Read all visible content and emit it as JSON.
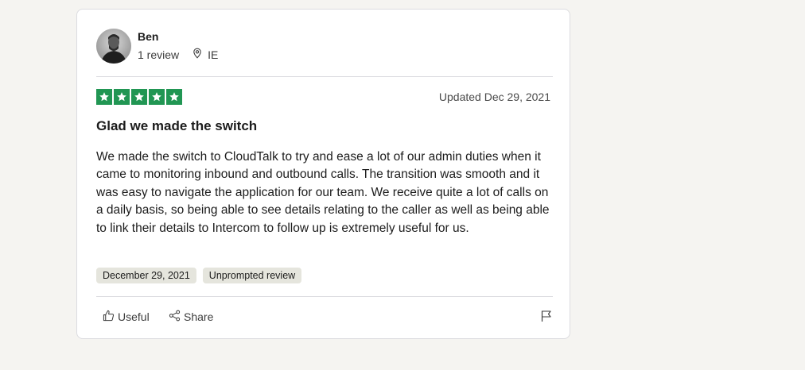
{
  "review": {
    "reviewer_name": "Ben",
    "review_count": "1 review",
    "country": "IE",
    "rating": 5,
    "star_color": "#219653",
    "updated": "Updated Dec 29, 2021",
    "title": "Glad we made the switch",
    "body": "We made the switch to CloudTalk to try and ease a lot of our admin duties when it came to monitoring inbound and outbound calls. The transition was smooth and it was easy to navigate the application for our team. We receive quite a lot of calls on a daily basis, so being able to see details relating to the caller as well as being able to link their details to Intercom to follow up is extremely useful for us.",
    "tags": [
      "December 29, 2021",
      "Unprompted review"
    ]
  },
  "actions": {
    "useful_label": "Useful",
    "share_label": "Share"
  },
  "icons": {
    "location": "location-pin-icon",
    "useful": "thumbs-up-icon",
    "share": "share-icon",
    "flag": "flag-icon",
    "star": "star-icon"
  }
}
